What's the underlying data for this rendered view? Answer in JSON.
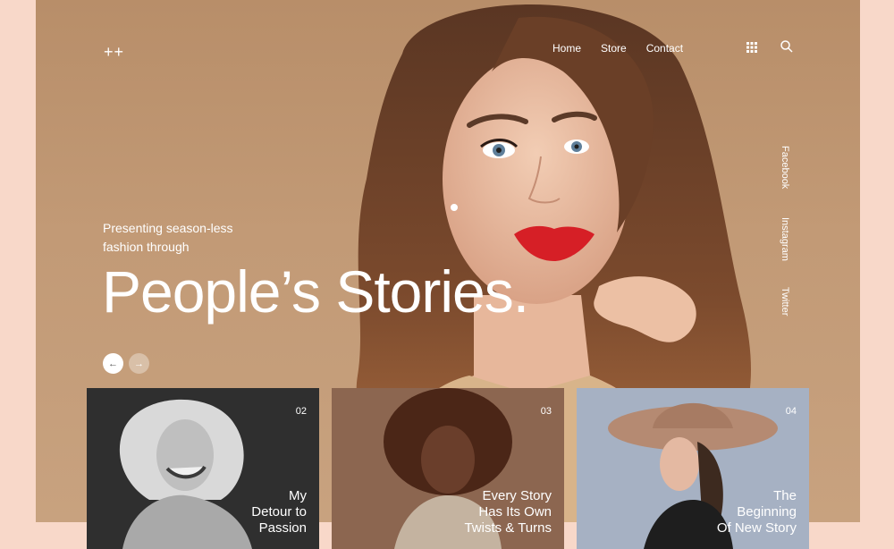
{
  "brand": {
    "logo": "++"
  },
  "nav": {
    "items": [
      "Home",
      "Store",
      "Contact"
    ]
  },
  "social": [
    "Facebook",
    "Instagram",
    "Twitter"
  ],
  "hero": {
    "intro": "Presenting season-less fashion through",
    "headline": "People’s Stories.",
    "prev_icon": "←",
    "next_icon": "→"
  },
  "cards": [
    {
      "number": "02",
      "title_lines": [
        "My",
        "Detour to",
        "Passion"
      ]
    },
    {
      "number": "03",
      "title_lines": [
        "Every Story",
        "Has Its Own",
        "Twists & Turns"
      ]
    },
    {
      "number": "04",
      "title_lines": [
        "The",
        "Beginning",
        "Of New Story"
      ]
    }
  ],
  "colors": {
    "page_bg": "#f8d8c9",
    "hero_bg": "#c29a76",
    "lips": "#d61f26",
    "card2_bg": "#3a3a3a",
    "card3_bg": "#8f6a52",
    "card4_bg": "#a7b2c4"
  },
  "icons": {
    "grid": "grid-icon",
    "search": "search-icon"
  }
}
